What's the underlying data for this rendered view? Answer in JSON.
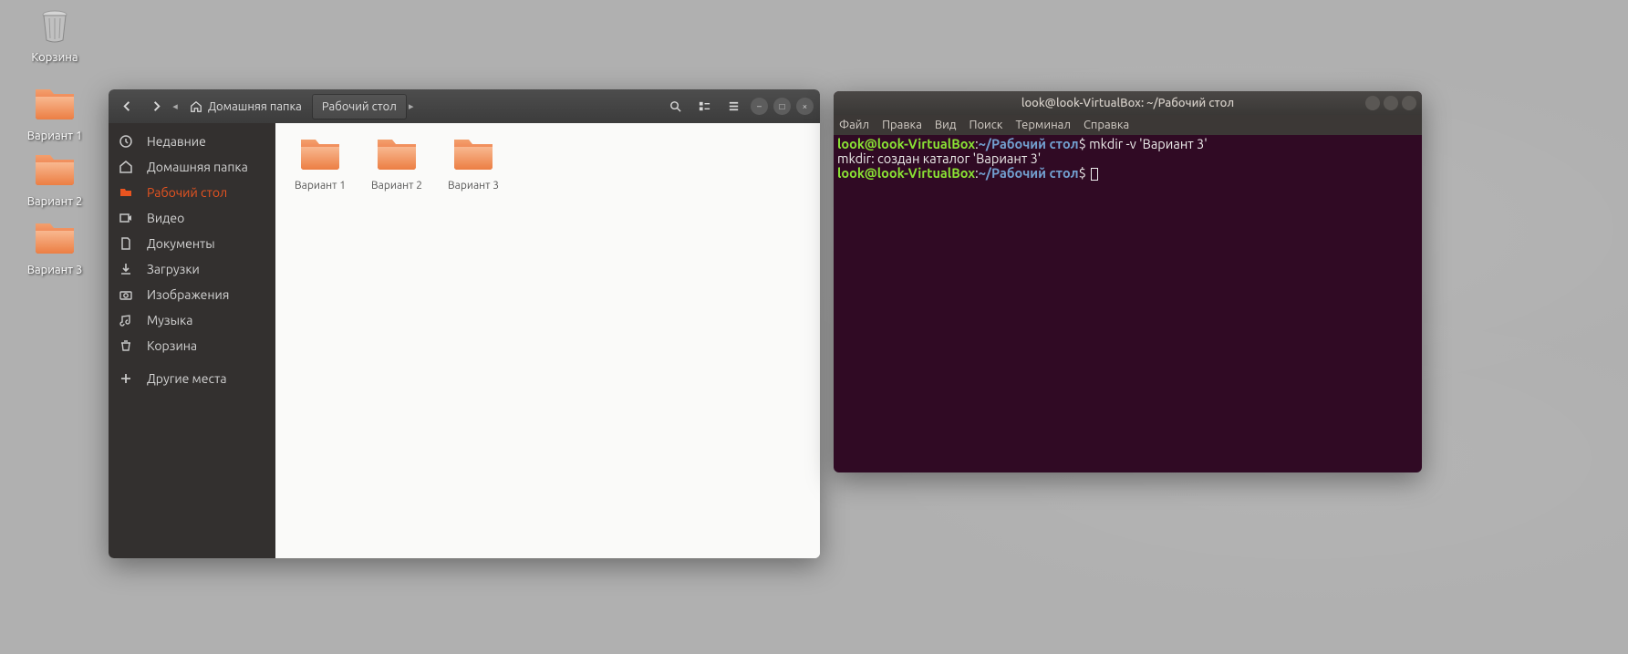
{
  "desktop": {
    "trash_label": "Корзина",
    "icons": [
      {
        "label": "Вариант 1"
      },
      {
        "label": "Вариант 2"
      },
      {
        "label": "Вариант 3"
      }
    ]
  },
  "filemanager": {
    "path_home": "Домашняя папка",
    "path_current": "Рабочий стол",
    "sidebar": [
      {
        "label": "Недавние"
      },
      {
        "label": "Домашняя папка"
      },
      {
        "label": "Рабочий стол"
      },
      {
        "label": "Видео"
      },
      {
        "label": "Документы"
      },
      {
        "label": "Загрузки"
      },
      {
        "label": "Изображения"
      },
      {
        "label": "Музыка"
      },
      {
        "label": "Корзина"
      },
      {
        "label": "Другие места"
      }
    ],
    "files": [
      {
        "name": "Вариант 1"
      },
      {
        "name": "Вариант 2"
      },
      {
        "name": "Вариант 3"
      }
    ]
  },
  "terminal": {
    "title": "look@look-VirtualBox: ~/Рабочий стол",
    "menu": {
      "file": "Файл",
      "edit": "Правка",
      "view": "Вид",
      "search": "Поиск",
      "terminal": "Терминал",
      "help": "Справка"
    },
    "line1_userhost": "look@look-VirtualBox",
    "line1_path": "~/Рабочий стол",
    "line1_cmd": "mkdir -v 'Вариант 3'",
    "line2": "mkdir: создан каталог 'Вариант 3'",
    "line3_userhost": "look@look-VirtualBox",
    "line3_path": "~/Рабочий стол"
  }
}
